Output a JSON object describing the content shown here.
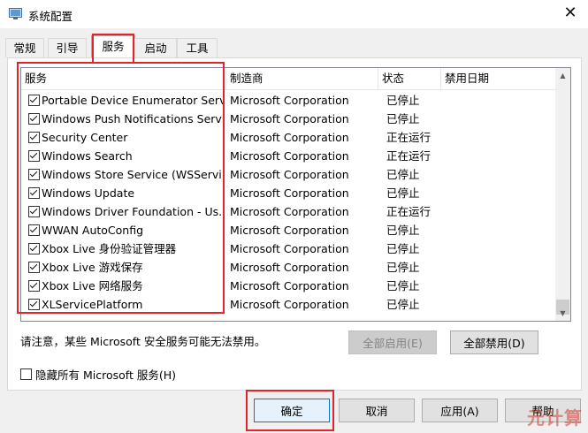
{
  "window": {
    "title": "系统配置",
    "close_glyph": "✕"
  },
  "tabs": [
    {
      "label": "常规"
    },
    {
      "label": "引导"
    },
    {
      "label": "服务",
      "active": true
    },
    {
      "label": "启动"
    },
    {
      "label": "工具"
    }
  ],
  "services": {
    "columns": [
      "服务",
      "制造商",
      "状态",
      "禁用日期"
    ],
    "rows": [
      {
        "name": "Portable Device Enumerator Serv...",
        "maker": "Microsoft Corporation",
        "status": "已停止",
        "checked": true
      },
      {
        "name": "Windows Push Notifications Servi...",
        "maker": "Microsoft Corporation",
        "status": "已停止",
        "checked": true
      },
      {
        "name": "Security Center",
        "maker": "Microsoft Corporation",
        "status": "正在运行",
        "checked": true
      },
      {
        "name": "Windows Search",
        "maker": "Microsoft Corporation",
        "status": "正在运行",
        "checked": true
      },
      {
        "name": "Windows Store Service (WSServi...",
        "maker": "Microsoft Corporation",
        "status": "已停止",
        "checked": true
      },
      {
        "name": "Windows Update",
        "maker": "Microsoft Corporation",
        "status": "已停止",
        "checked": true
      },
      {
        "name": "Windows Driver Foundation - Us...",
        "maker": "Microsoft Corporation",
        "status": "正在运行",
        "checked": true
      },
      {
        "name": "WWAN AutoConfig",
        "maker": "Microsoft Corporation",
        "status": "已停止",
        "checked": true
      },
      {
        "name": "Xbox Live 身份验证管理器",
        "maker": "Microsoft Corporation",
        "status": "已停止",
        "checked": true
      },
      {
        "name": "Xbox Live 游戏保存",
        "maker": "Microsoft Corporation",
        "status": "已停止",
        "checked": true
      },
      {
        "name": "Xbox Live 网络服务",
        "maker": "Microsoft Corporation",
        "status": "已停止",
        "checked": true
      },
      {
        "name": "XLServicePlatform",
        "maker": "Microsoft Corporation",
        "status": "已停止",
        "checked": true
      }
    ]
  },
  "notice": "请注意，某些 Microsoft 安全服务可能无法禁用。",
  "buttons": {
    "enable_all": "全部启用(E)",
    "disable_all": "全部禁用(D)",
    "ok": "确定",
    "cancel": "取消",
    "apply": "应用(A)",
    "help": "帮助"
  },
  "hide_ms": {
    "label": "隐藏所有 Microsoft 服务(H)",
    "checked": false
  },
  "watermark": "元计算",
  "colors": {
    "highlight": "#e0262a",
    "accent": "#0078d7"
  }
}
